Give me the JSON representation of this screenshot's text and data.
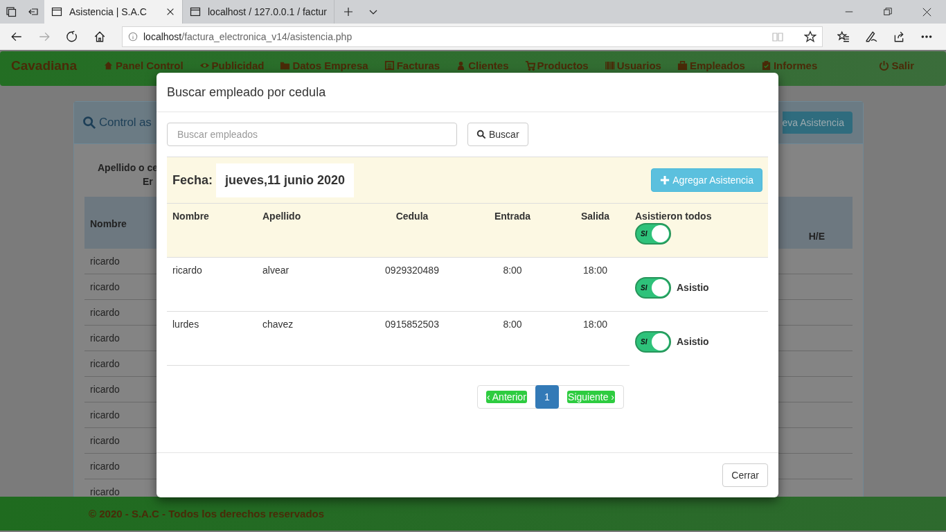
{
  "browser": {
    "tabs": [
      {
        "title": "Asistencia | S.A.C",
        "selected": true
      },
      {
        "title": "localhost / 127.0.0.1 / factur",
        "selected": false
      }
    ],
    "address": {
      "host": "localhost",
      "path": "/factura_electronica_v14/asistencia.php"
    }
  },
  "navbar": {
    "brand": "Cavadiana",
    "items": [
      {
        "label": "Panel Control"
      },
      {
        "label": "Publicidad"
      },
      {
        "label": "Datos Empresa"
      },
      {
        "label": "Facturas"
      },
      {
        "label": "Clientes"
      },
      {
        "label": "Productos"
      },
      {
        "label": "Usuarios"
      },
      {
        "label": "Empleados"
      },
      {
        "label": "Informes"
      }
    ],
    "logout": "Salir"
  },
  "background_panel": {
    "title": "Control as",
    "button": "eva Asistencia",
    "filter_label": [
      "Apellido o ce",
      "Er"
    ],
    "columns": [
      "Nombre",
      "H/E"
    ],
    "rows": [
      "ricardo",
      "ricardo",
      "ricardo",
      "ricardo",
      "ricardo",
      "ricardo",
      "ricardo",
      "ricardo",
      "ricardo",
      "ricardo"
    ]
  },
  "footer": "© 2020 - S.A.C - Todos los derechos reservados",
  "modal": {
    "title": "Buscar empleado por cedula",
    "search": {
      "placeholder": "Buscar empleados",
      "button": "Buscar"
    },
    "date_label": "Fecha:",
    "date": "jueves,11 junio 2020",
    "add_button": "Agregar Asistencia",
    "columns": [
      "Nombre",
      "Apellido",
      "Cedula",
      "Entrada",
      "Salida",
      "Asistieron todos"
    ],
    "all_toggle": {
      "on": true,
      "label": "SI"
    },
    "rows": [
      {
        "nombre": "ricardo",
        "apellido": "alvear",
        "cedula": "0929320489",
        "entrada": "8:00",
        "salida": "18:00",
        "toggle": {
          "on": true,
          "label": "SI"
        },
        "status": "Asistio"
      },
      {
        "nombre": "lurdes",
        "apellido": "chavez",
        "cedula": "0915852503",
        "entrada": "8:00",
        "salida": "18:00",
        "toggle": {
          "on": true,
          "label": "SI"
        },
        "status": "Asistio"
      }
    ],
    "pagination": [
      {
        "label": "‹ Anterior",
        "selected": false
      },
      {
        "label": "1",
        "selected": true
      },
      {
        "label": "Siguiente ›",
        "selected": false
      }
    ],
    "close_button": "Cerrar"
  }
}
